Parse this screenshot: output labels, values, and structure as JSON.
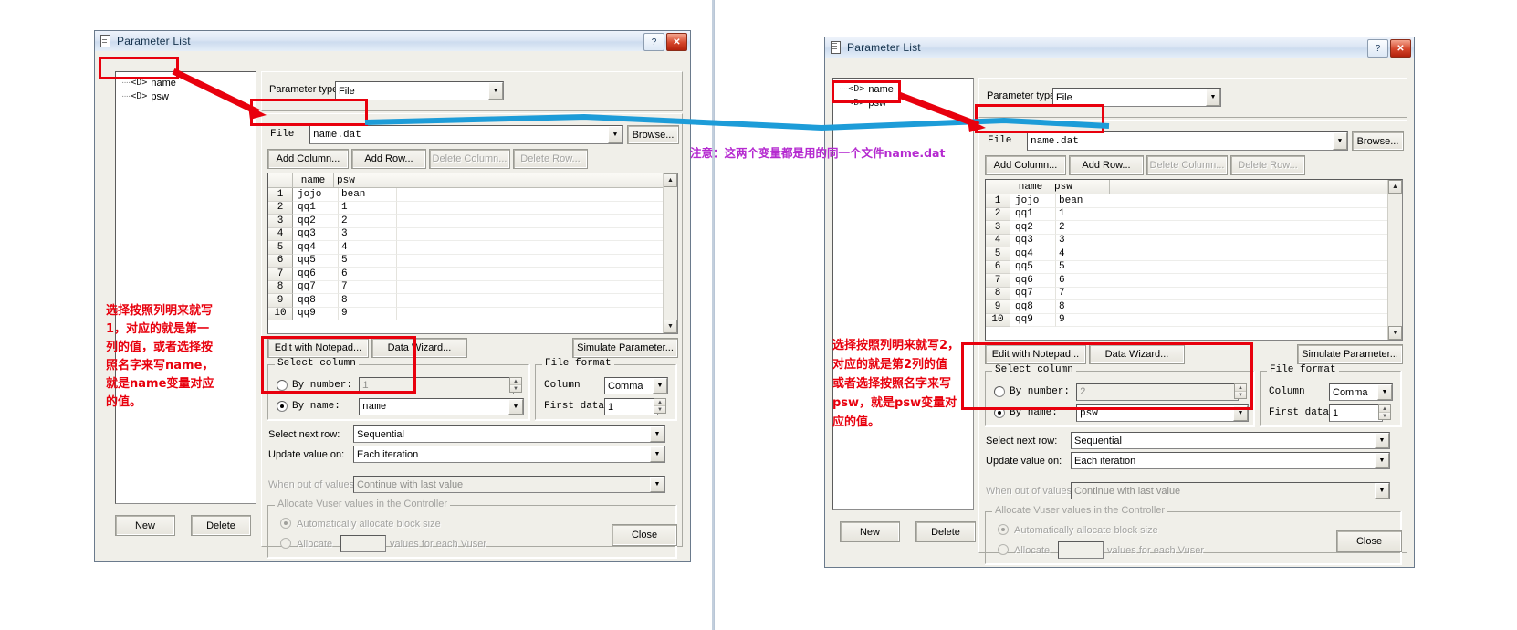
{
  "window": {
    "title": "Parameter List",
    "help_button": "?",
    "close_button": "✕",
    "close_label": "Close",
    "new_label": "New",
    "delete_label": "Delete"
  },
  "tree": {
    "items": [
      {
        "glyph": "<D>",
        "label": "name"
      },
      {
        "glyph": "<D>",
        "label": "psw"
      }
    ]
  },
  "form": {
    "parameter_type_label": "Parameter type:",
    "parameter_type_value": "File",
    "file_label": "File",
    "file_value": "name.dat",
    "browse_label": "Browse...",
    "add_column_label": "Add Column...",
    "add_row_label": "Add Row...",
    "delete_column_label": "Delete Column...",
    "delete_row_label": "Delete Row...",
    "edit_notepad_label": "Edit with Notepad...",
    "data_wizard_label": "Data Wizard...",
    "simulate_label": "Simulate Parameter...",
    "select_column_group": "Select column",
    "by_number_label": "By number:",
    "by_name_label": "By name:",
    "file_format_group": "File format",
    "column_label": "Column",
    "column_value": "Comma",
    "first_data_label": "First data",
    "first_data_value": "1",
    "select_next_row_label": "Select next row:",
    "select_next_row_value": "Sequential",
    "update_value_on_label": "Update value on:",
    "update_value_on_value": "Each iteration",
    "when_out_label": "When out of values:",
    "when_out_value": "Continue with last value",
    "allocate_group": "Allocate Vuser values in the Controller",
    "auto_allocate_label": "Automatically allocate block size",
    "allocate_label": "Allocate",
    "allocate_value": "",
    "allocate_suffix": "values for each Vuser"
  },
  "left_panel": {
    "selected_tree_item": "name",
    "by_number_value": "1",
    "by_name_value": "name",
    "annotation": "选择按照列明来就写\n1，对应的就是第一\n列的值，或者选择按\n照名字来写name，\n就是name变量对应\n的值。"
  },
  "right_panel": {
    "selected_tree_item": "psw",
    "by_number_value": "2",
    "by_name_value": "psw",
    "annotation": "选择按照列明来就写2，\n对应的就是第2列的值\n或者选择按照名字来写\npsw，就是psw变量对\n应的值。"
  },
  "middle_annotation": "注意：这两个变量都是用的同一个文件name.dat",
  "table": {
    "columns": [
      "name",
      "psw"
    ],
    "rows": [
      {
        "n": "1",
        "name": "jojo",
        "psw": "bean"
      },
      {
        "n": "2",
        "name": "qq1",
        "psw": "1"
      },
      {
        "n": "3",
        "name": "qq2",
        "psw": "2"
      },
      {
        "n": "4",
        "name": "qq3",
        "psw": "3"
      },
      {
        "n": "5",
        "name": "qq4",
        "psw": "4"
      },
      {
        "n": "6",
        "name": "qq5",
        "psw": "5"
      },
      {
        "n": "7",
        "name": "qq6",
        "psw": "6"
      },
      {
        "n": "8",
        "name": "qq7",
        "psw": "7"
      },
      {
        "n": "9",
        "name": "qq8",
        "psw": "8"
      },
      {
        "n": "10",
        "name": "qq9",
        "psw": "9"
      }
    ]
  },
  "colors": {
    "annotation_red": "#e8000d",
    "annotation_blue": "#b52ad0",
    "connector_blue": "#1d9cd8"
  }
}
